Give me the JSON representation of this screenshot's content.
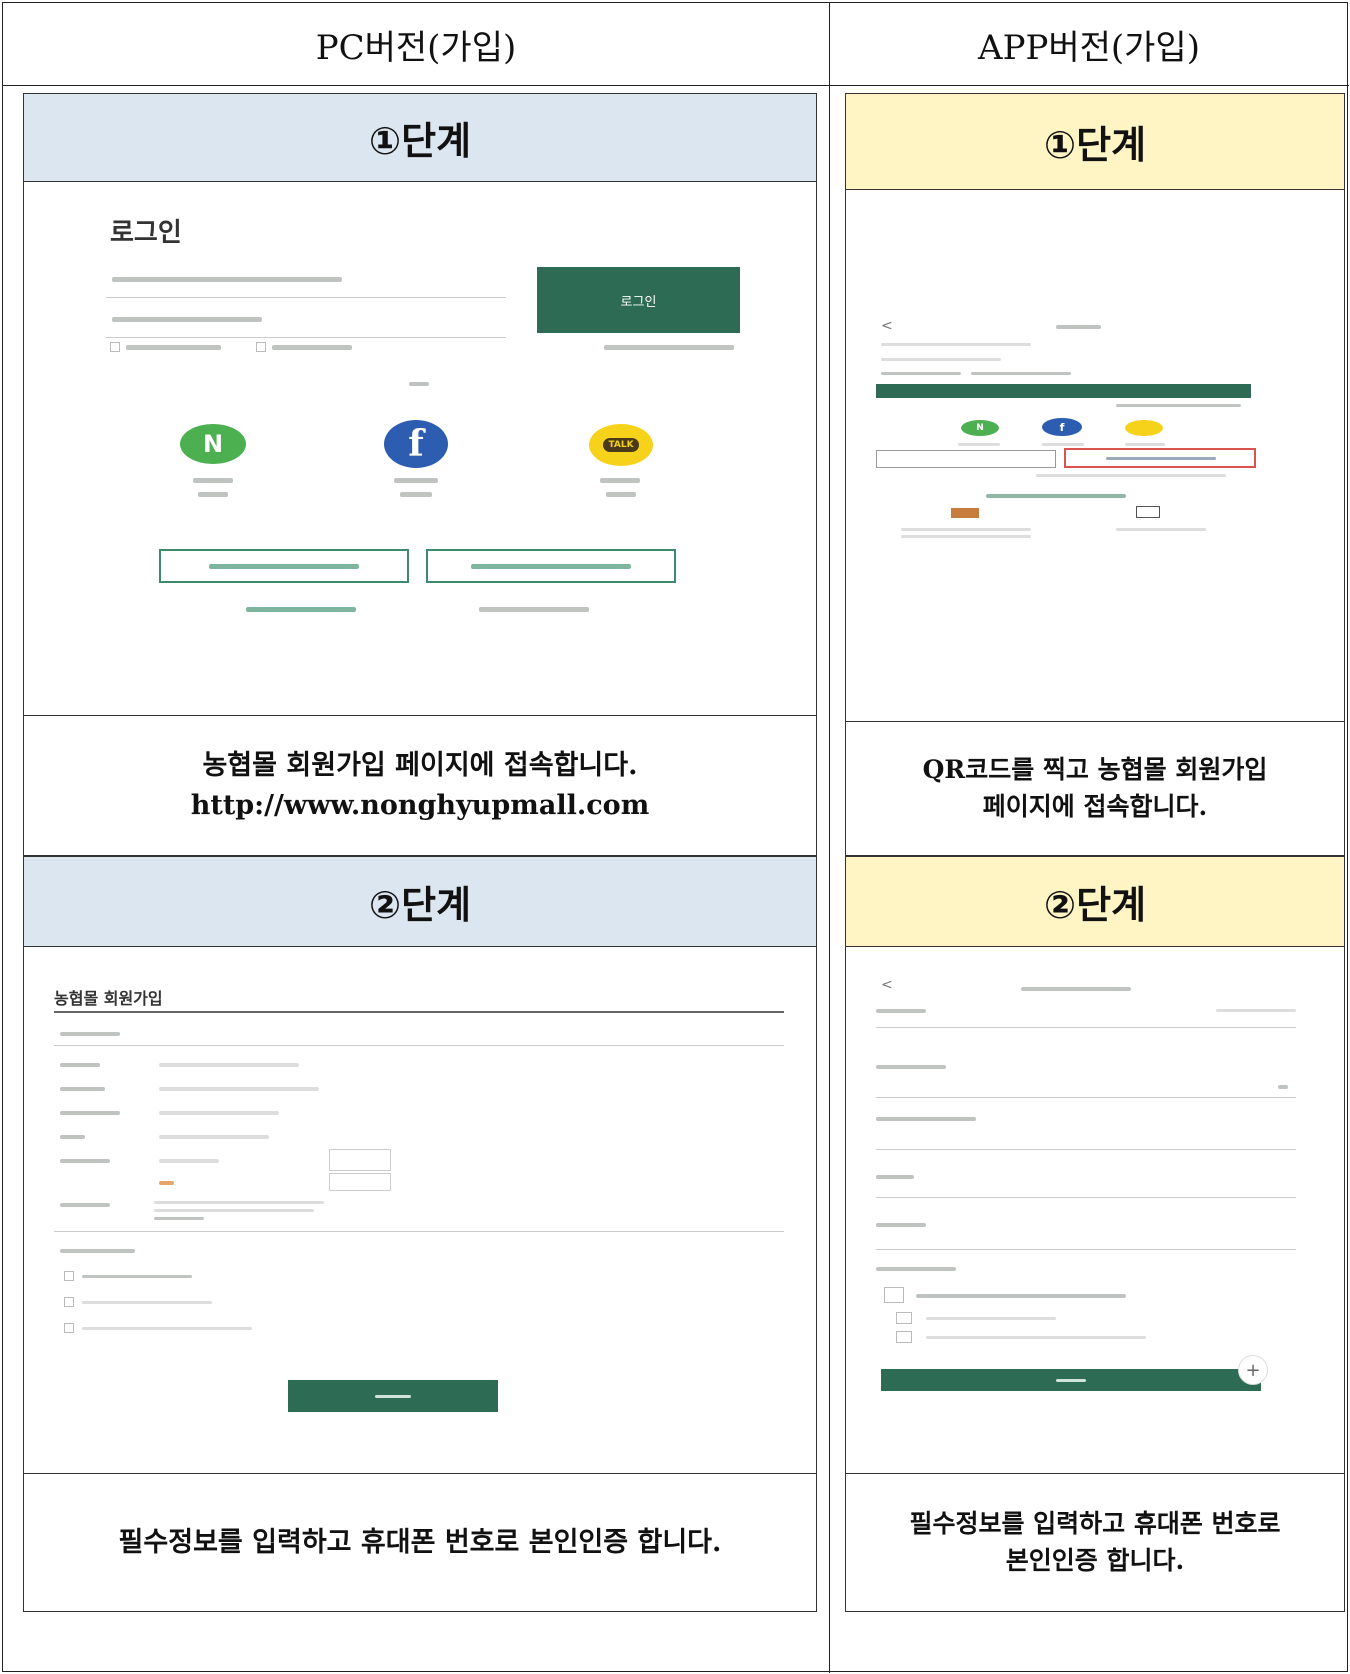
{
  "columns": {
    "pc": "PC버전(가입)",
    "app": "APP버전(가입)"
  },
  "steps": {
    "step1": "①단계",
    "step2": "②단계"
  },
  "pc_step1": {
    "title": "로그인",
    "login_button": "로그인",
    "caption_line1": "농협몰 회원가입 페이지에 접속합니다.",
    "caption_line2": "http://www.nonghyupmall.com"
  },
  "pc_step2": {
    "title": "농협몰 회원가입",
    "caption": "필수정보를 입력하고 휴대폰 번호로 본인인증 합니다."
  },
  "app_step1": {
    "caption_line1": "QR코드를 찍고 농협몰 회원가입",
    "caption_line2": "페이지에 접속합니다."
  },
  "app_step2": {
    "caption_line1": "필수정보를 입력하고 휴대폰 번호로",
    "caption_line2": "본인인증 합니다."
  },
  "colors": {
    "band_pc": "#dce6f1",
    "band_app": "#fff4c4",
    "brand_green": "#2e6b55",
    "naver": "#4caf50",
    "facebook": "#2d5db0",
    "kakao": "#f7d21a"
  },
  "icons": [
    "naver-icon",
    "facebook-icon",
    "kakao-icon",
    "back-arrow-icon"
  ]
}
